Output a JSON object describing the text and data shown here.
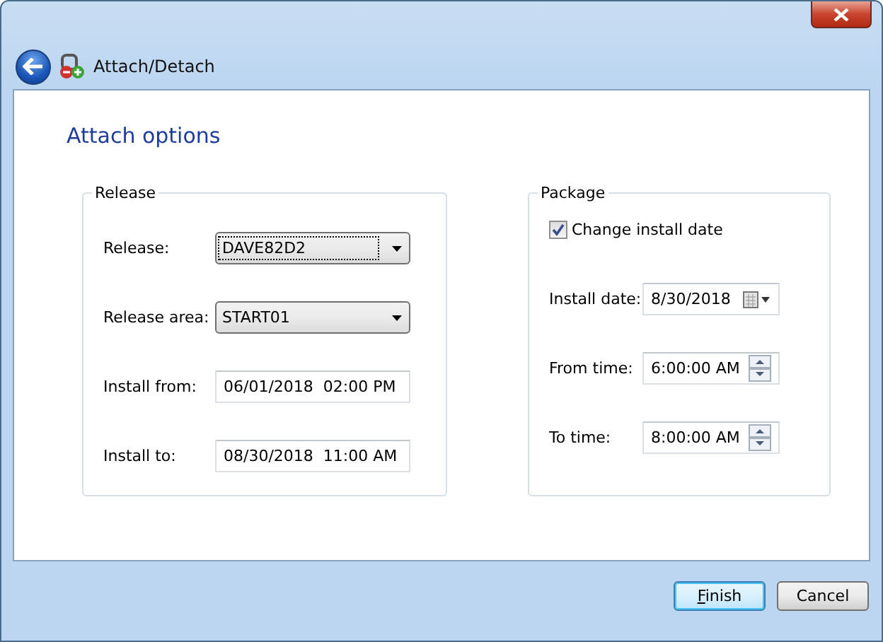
{
  "window": {
    "title": "Attach/Detach"
  },
  "heading": "Attach options",
  "release_group": {
    "title": "Release",
    "fields": [
      {
        "kind": "dropdown",
        "label": "Release:",
        "value": "DAVE82D2",
        "focused": true
      },
      {
        "kind": "dropdown",
        "label": "Release area:",
        "value": "START01",
        "focused": false
      },
      {
        "kind": "text",
        "label": "Install from:",
        "value": "06/01/2018  02:00 PM"
      },
      {
        "kind": "text",
        "label": "Install to:",
        "value": "08/30/2018  11:00 AM"
      }
    ]
  },
  "package_group": {
    "title": "Package",
    "checkbox": {
      "label": "Change install date",
      "checked": true
    },
    "fields": [
      {
        "kind": "date",
        "label": "Install date:",
        "value": "8/30/2018"
      },
      {
        "kind": "spin",
        "label": "From time:",
        "value": "6:00:00 AM"
      },
      {
        "kind": "spin",
        "label": "To time:",
        "value": "8:00:00 AM"
      }
    ]
  },
  "buttons": [
    {
      "label": "Finish",
      "default": true,
      "access_key_underlined": true
    },
    {
      "label": "Cancel",
      "default": false,
      "access_key_underlined": false
    }
  ]
}
